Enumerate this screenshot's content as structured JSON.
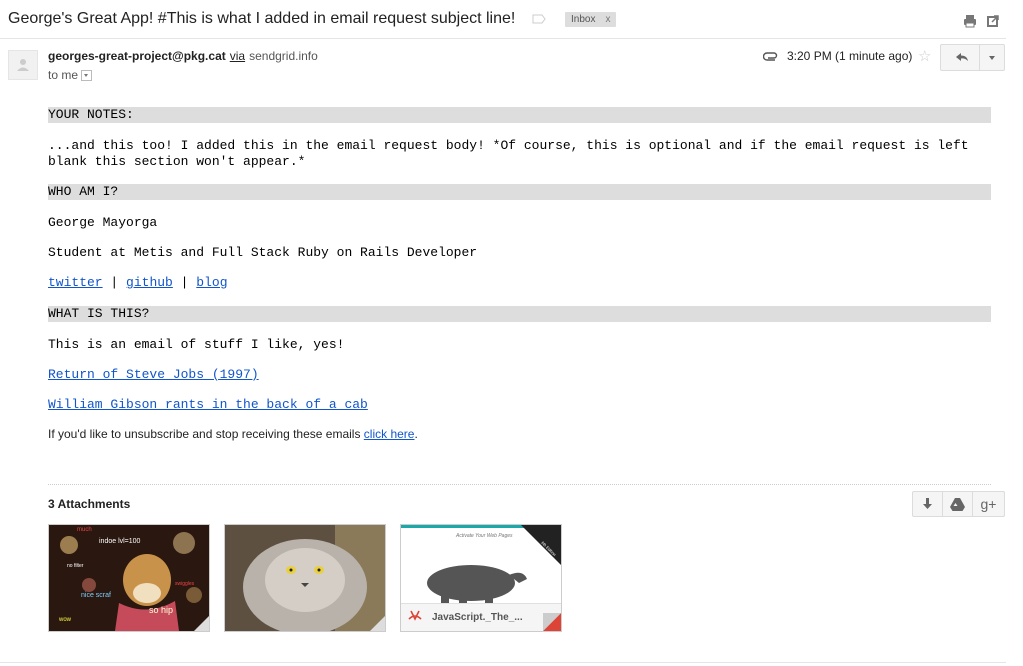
{
  "subject": "George's Great App! #This is what I added in email request subject line!",
  "inbox_chip": {
    "label": "Inbox",
    "close": "x"
  },
  "header": {
    "sender_email": "georges-great-project@pkg.cat",
    "via_label": "via",
    "via_domain": "sendgrid.info",
    "to_label": "to me",
    "time": "3:20 PM (1 minute ago)"
  },
  "body": {
    "notes_heading": "YOUR NOTES:",
    "notes_text": "...and this too! I added this in the email request body! *Of course, this is optional and if the email request is left blank this section won't appear.*",
    "who_heading": "WHO AM I?",
    "name": "George Mayorga",
    "bio": "Student at Metis and Full Stack Ruby on Rails Developer",
    "links": [
      "twitter",
      "github",
      "blog"
    ],
    "link_sep": "|",
    "what_heading": "WHAT IS THIS?",
    "what_text": "This is an email of stuff I like, yes!",
    "link_steve": "Return of Steve Jobs (1997)",
    "link_gibson": "William Gibson rants in the back of a cab",
    "unsub_text": "If you'd like to unsubscribe and stop receiving these emails ",
    "unsub_link": "click here",
    "unsub_end": "."
  },
  "attachments": {
    "title": "3 Attachments",
    "gplus_label": "g+",
    "items": [
      {
        "kind": "image",
        "words": [
          "wow",
          "much",
          "nice scraf",
          "so hip",
          "indoe lvl=100",
          "no filter",
          "swiggles"
        ]
      },
      {
        "kind": "image"
      },
      {
        "kind": "pdf",
        "name": "JavaScript._The_...",
        "cover_caption": "Activate Your Web Pages",
        "ribbon": "6th Edition"
      }
    ]
  },
  "colors": {
    "link": "#1155cc",
    "section_bar": "#dddddd",
    "pdf_red": "#db4437",
    "teal": "#1aa8a8"
  }
}
